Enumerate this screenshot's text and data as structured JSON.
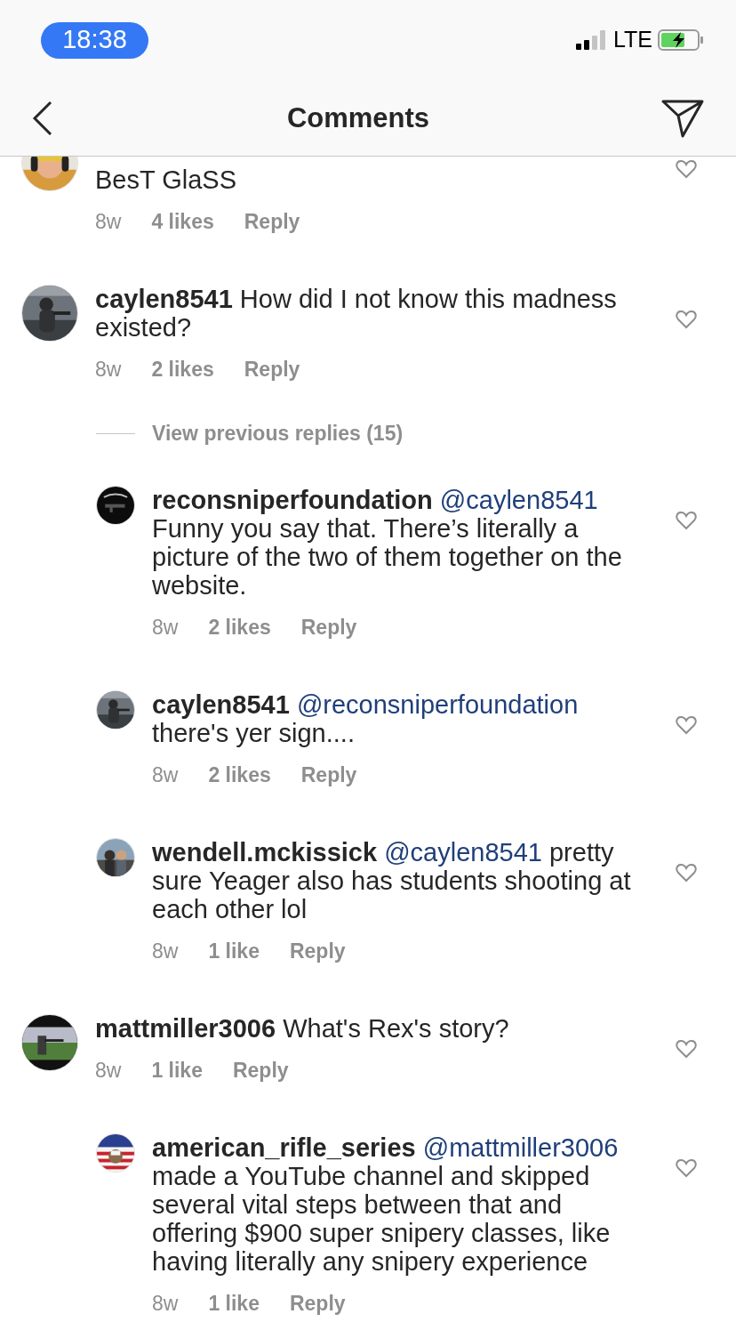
{
  "status_bar": {
    "time": "18:38",
    "network": "LTE",
    "charging": true
  },
  "header": {
    "title": "Comments"
  },
  "comments": [
    {
      "text": "BesT GlaSS",
      "time": "8w",
      "likes": "4 likes",
      "reply": "Reply",
      "liked": false
    },
    {
      "username": "caylen8541",
      "text": "How did I not know this madness existed?",
      "time": "8w",
      "likes": "2 likes",
      "reply": "Reply",
      "liked": false,
      "view_replies": "View previous replies (15)",
      "replies": [
        {
          "username": "reconsniperfoundation",
          "mention": "@caylen8541",
          "text": "Funny you say that. There’s literally a picture of the two of them together on the website.",
          "time": "8w",
          "likes": "2 likes",
          "reply": "Reply",
          "liked": false
        },
        {
          "username": "caylen8541",
          "mention": "@reconsniperfoundation",
          "text": "there's yer sign....",
          "time": "8w",
          "likes": "2 likes",
          "reply": "Reply",
          "liked": false
        },
        {
          "username": "wendell.mckissick",
          "mention": "@caylen8541",
          "text": "pretty sure Yeager also has students shooting at each other lol",
          "time": "8w",
          "likes": "1 like",
          "reply": "Reply",
          "liked": false
        }
      ]
    },
    {
      "username": "mattmiller3006",
      "text": "What's Rex's story?",
      "time": "8w",
      "likes": "1 like",
      "reply": "Reply",
      "liked": false,
      "replies": [
        {
          "username": "american_rifle_series",
          "mention": "@mattmiller3006",
          "text": "made a YouTube channel and skipped several vital steps between that and offering $900 super snipery classes,  like having literally any snipery experience",
          "time": "8w",
          "likes": "1 like",
          "reply": "Reply",
          "liked": false
        }
      ]
    }
  ]
}
